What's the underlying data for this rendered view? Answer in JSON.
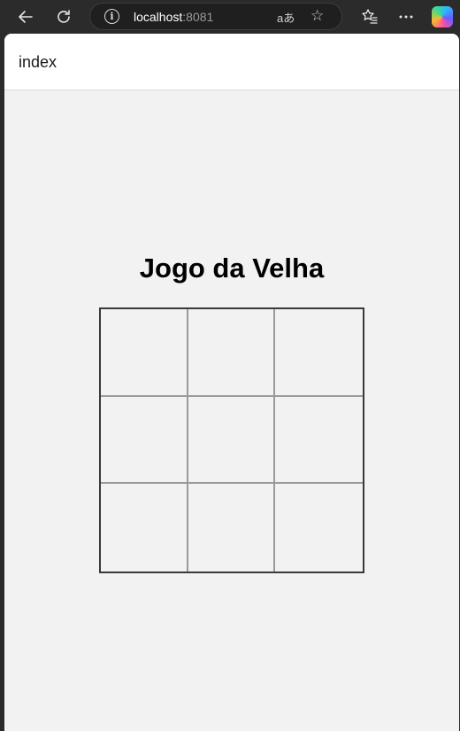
{
  "browser": {
    "url_host": "localhost",
    "url_port": ":8081",
    "icons": {
      "back": "back-arrow-icon",
      "reload": "reload-icon",
      "info": "info-icon",
      "translate": "translate-icon",
      "favorite": "star-icon",
      "favorites_list": "favorites-list-icon",
      "more": "more-icon",
      "copilot": "copilot-icon"
    },
    "translate_glyph": "aあ",
    "info_glyph": "i"
  },
  "app": {
    "header_title": "index",
    "game_title": "Jogo da Velha",
    "board": [
      "",
      "",
      "",
      "",
      "",
      "",
      "",
      "",
      ""
    ]
  }
}
